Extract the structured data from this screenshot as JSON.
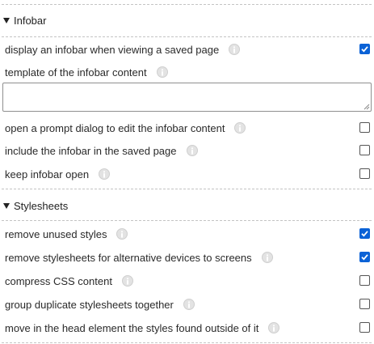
{
  "sections": {
    "infobar": {
      "title": "Infobar",
      "options": [
        {
          "label": "display an infobar when viewing a saved page",
          "checked": true
        },
        {
          "label": "template of the infobar content"
        },
        {
          "label": "open a prompt dialog to edit the infobar content",
          "checked": false
        },
        {
          "label": "include the infobar in the saved page",
          "checked": false
        },
        {
          "label": "keep infobar open",
          "checked": false
        }
      ],
      "template_value": ""
    },
    "stylesheets": {
      "title": "Stylesheets",
      "options": [
        {
          "label": "remove unused styles",
          "checked": true
        },
        {
          "label": "remove stylesheets for alternative devices to screens",
          "checked": true
        },
        {
          "label": "compress CSS content",
          "checked": false
        },
        {
          "label": "group duplicate stylesheets together",
          "checked": false
        },
        {
          "label": "move in the head element the styles found outside of it",
          "checked": false
        }
      ]
    }
  },
  "icons": {
    "expand": "triangle-down-icon",
    "help": "info-icon",
    "check": "checkmark-icon"
  },
  "colors": {
    "accent": "#0b62d6",
    "divider": "#c4c4c4"
  }
}
